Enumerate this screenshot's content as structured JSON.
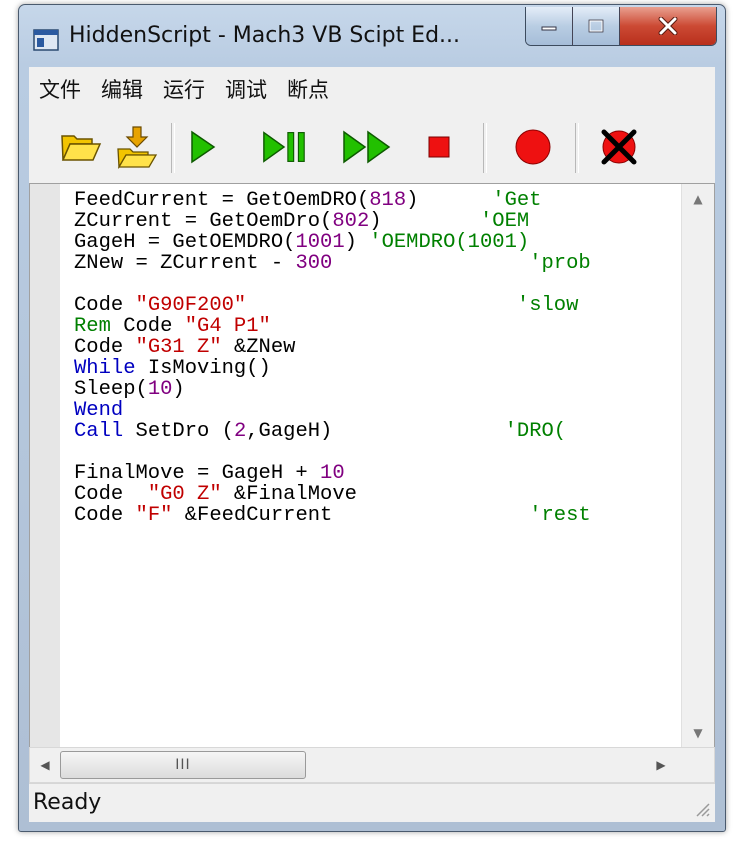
{
  "window": {
    "title": "HiddenScript - Mach3 VB Scipt Ed..."
  },
  "menu": [
    "文件",
    "编辑",
    "运行",
    "调试",
    "断点"
  ],
  "toolbar": {
    "buttons": [
      "open-folder-icon",
      "save-load-icon",
      "run-icon",
      "step-pause-icon",
      "fast-forward-icon",
      "stop-icon",
      "breakpoint-icon",
      "clear-breakpoint-icon"
    ]
  },
  "colors": {
    "comment": "#008000",
    "string": "#c00000",
    "number": "#800080",
    "keyword": "#0000c0"
  },
  "code_lines": [
    [
      {
        "t": "FeedCurrent = GetOemDRO("
      },
      {
        "t": "818",
        "c": "num"
      },
      {
        "t": ")      "
      },
      {
        "t": "'Get",
        "c": "cmt"
      }
    ],
    [
      {
        "t": "ZCurrent = GetOemDro("
      },
      {
        "t": "802",
        "c": "num"
      },
      {
        "t": ")        "
      },
      {
        "t": "'OEM",
        "c": "cmt"
      }
    ],
    [
      {
        "t": "GageH = GetOEMDRO("
      },
      {
        "t": "1001",
        "c": "num"
      },
      {
        "t": ") "
      },
      {
        "t": "'OEMDRO(1001)",
        "c": "cmt"
      }
    ],
    [
      {
        "t": "ZNew = ZCurrent - "
      },
      {
        "t": "300",
        "c": "num"
      },
      {
        "t": "                "
      },
      {
        "t": "'prob",
        "c": "cmt"
      }
    ],
    [
      {
        "t": ""
      }
    ],
    [
      {
        "t": "Code "
      },
      {
        "t": "\"G90F200\"",
        "c": "str"
      },
      {
        "t": "                      "
      },
      {
        "t": "'slow",
        "c": "cmt"
      }
    ],
    [
      {
        "t": "Rem",
        "c": "cmt"
      },
      {
        "t": " Code "
      },
      {
        "t": "\"G4 P1\"",
        "c": "str"
      }
    ],
    [
      {
        "t": "Code "
      },
      {
        "t": "\"G31 Z\"",
        "c": "str"
      },
      {
        "t": " &ZNew"
      }
    ],
    [
      {
        "t": "While",
        "c": "kw"
      },
      {
        "t": " IsMoving()"
      }
    ],
    [
      {
        "t": "Sleep("
      },
      {
        "t": "10",
        "c": "num"
      },
      {
        "t": ")"
      }
    ],
    [
      {
        "t": "Wend",
        "c": "kw"
      }
    ],
    [
      {
        "t": "Call",
        "c": "kw"
      },
      {
        "t": " SetDro ("
      },
      {
        "t": "2",
        "c": "num"
      },
      {
        "t": ",GageH)              "
      },
      {
        "t": "'DRO(",
        "c": "cmt"
      }
    ],
    [
      {
        "t": ""
      }
    ],
    [
      {
        "t": "FinalMove = GageH + "
      },
      {
        "t": "10",
        "c": "num"
      }
    ],
    [
      {
        "t": "Code  "
      },
      {
        "t": "\"G0 Z\"",
        "c": "str"
      },
      {
        "t": " &FinalMove"
      }
    ],
    [
      {
        "t": "Code "
      },
      {
        "t": "\"F\"",
        "c": "str"
      },
      {
        "t": " &FeedCurrent                "
      },
      {
        "t": "'rest",
        "c": "cmt"
      }
    ]
  ],
  "scrollbar": {
    "thumb_grip": "III"
  },
  "status": {
    "text": "Ready"
  }
}
